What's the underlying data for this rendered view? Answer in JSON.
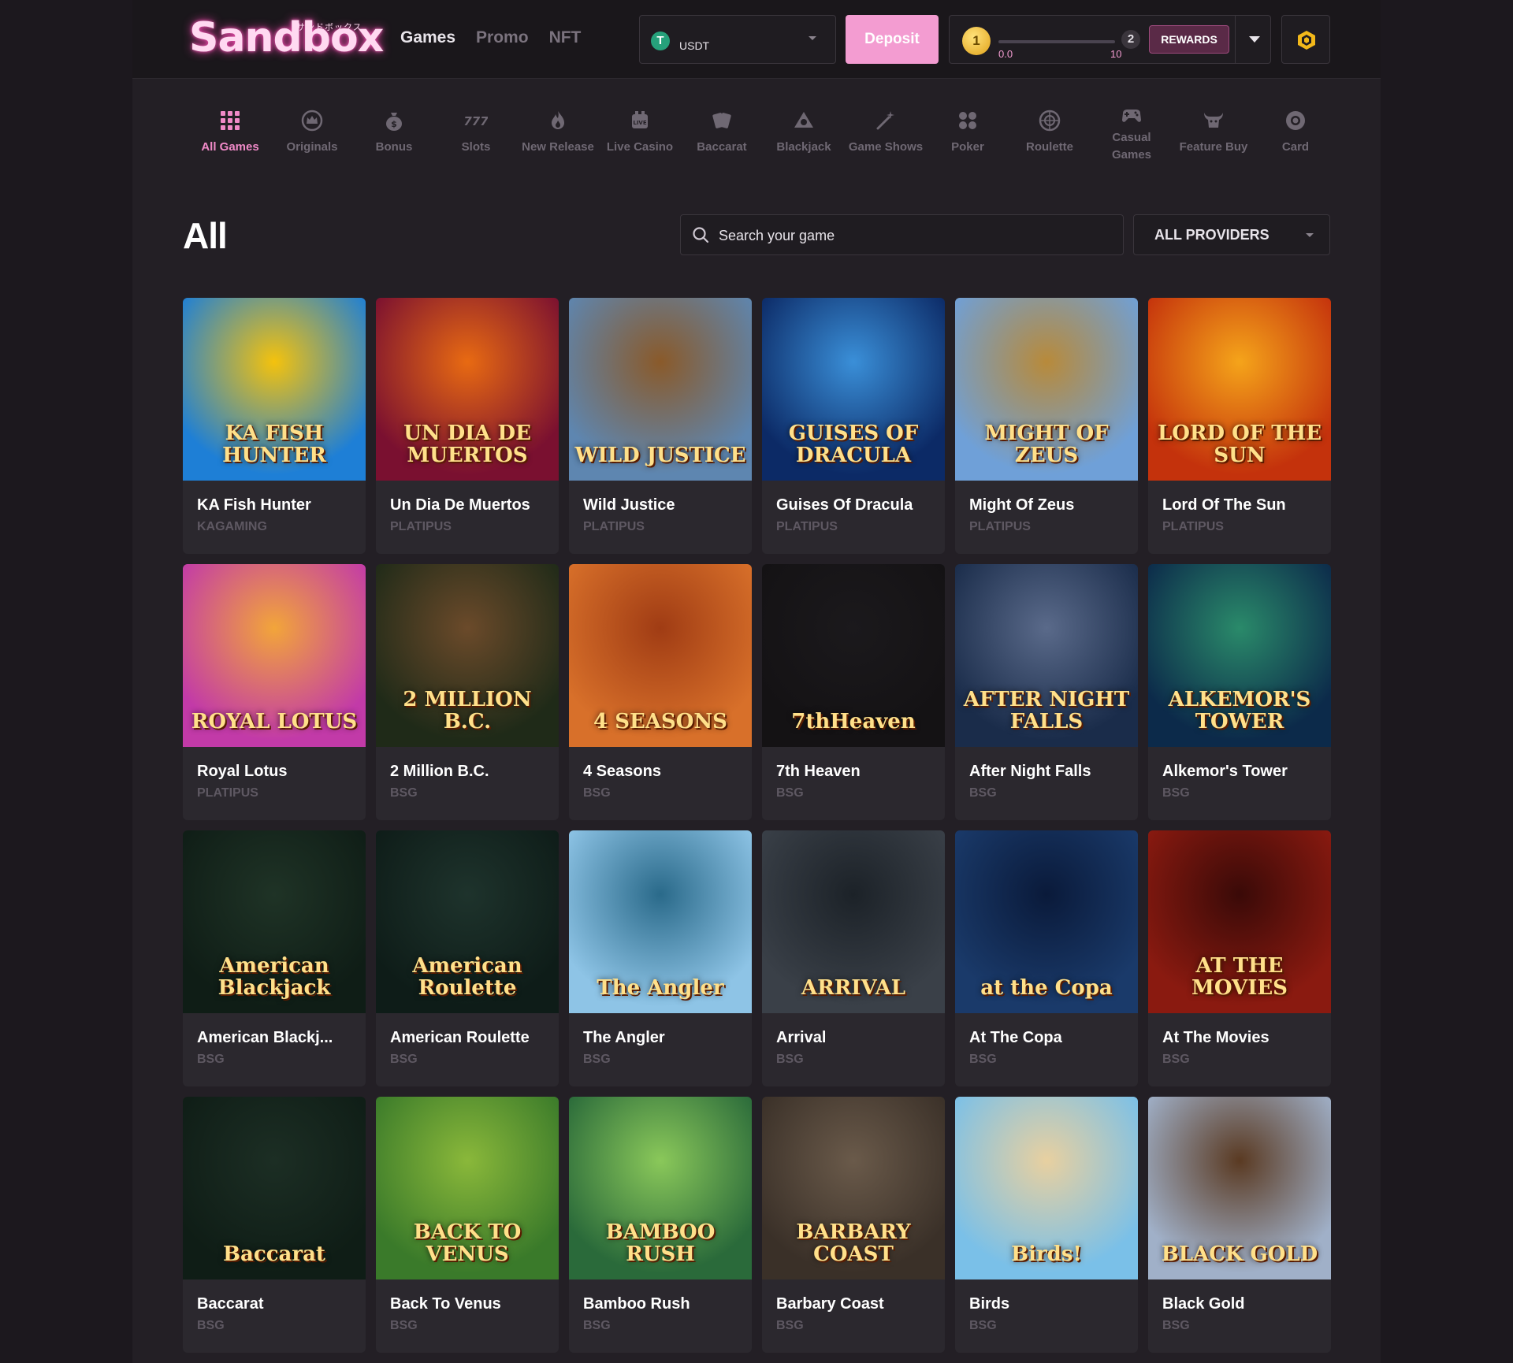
{
  "header": {
    "logo": "Sandbox",
    "logo_sub": "サンドボックス",
    "nav": [
      "Games",
      "Promo",
      "NFT"
    ],
    "wallet_currency": "USDT",
    "tether_glyph": "T",
    "deposit_label": "Deposit",
    "level_current": "1",
    "level_next": "2",
    "progress_min": "0.0",
    "progress_max": "10",
    "progress_fraction": 0.0,
    "rewards_label": "REWARDS"
  },
  "categories": [
    {
      "label": "All Games",
      "icon": "grid-icon"
    },
    {
      "label": "Originals",
      "icon": "crown-badge-icon"
    },
    {
      "label": "Bonus",
      "icon": "money-bag-icon"
    },
    {
      "label": "Slots",
      "icon": "slots-777-icon"
    },
    {
      "label": "New Release",
      "icon": "flame-icon"
    },
    {
      "label": "Live Casino",
      "icon": "live-casino-icon"
    },
    {
      "label": "Baccarat",
      "icon": "cards-icon"
    },
    {
      "label": "Blackjack",
      "icon": "club-chip-icon"
    },
    {
      "label": "Game Shows",
      "icon": "magic-wand-icon"
    },
    {
      "label": "Poker",
      "icon": "poker-suits-icon"
    },
    {
      "label": "Roulette",
      "icon": "roulette-wheel-icon"
    },
    {
      "label": "Casual Games",
      "icon": "gamepad-icon"
    },
    {
      "label": "Feature Buy",
      "icon": "bull-icon"
    },
    {
      "label": "Card",
      "icon": "chip-icon"
    }
  ],
  "section_title": "All",
  "search": {
    "placeholder": "Search your game"
  },
  "providers_label": "ALL PROVIDERS",
  "games": [
    {
      "name": "KA Fish Hunter",
      "provider": "KAGAMING",
      "art": "KA FISH HUNTER",
      "colors": [
        "#1e7fd6",
        "#f4c20d"
      ]
    },
    {
      "name": "Un Dia De Muertos",
      "provider": "PLATIPUS",
      "art": "UN DIA DE MUERTOS",
      "colors": [
        "#7a1030",
        "#e86a12"
      ]
    },
    {
      "name": "Wild Justice",
      "provider": "PLATIPUS",
      "art": "WILD JUSTICE",
      "colors": [
        "#5e86b0",
        "#8a5a2a"
      ]
    },
    {
      "name": "Guises Of Dracula",
      "provider": "PLATIPUS",
      "art": "GUISES OF DRACULA",
      "colors": [
        "#0c2a66",
        "#3a8fd8"
      ]
    },
    {
      "name": "Might Of Zeus",
      "provider": "PLATIPUS",
      "art": "MIGHT OF ZEUS",
      "colors": [
        "#6fa0d8",
        "#b88a3a"
      ]
    },
    {
      "name": "Lord Of The Sun",
      "provider": "PLATIPUS",
      "art": "LORD OF THE SUN",
      "colors": [
        "#c4320c",
        "#f5a41a"
      ]
    },
    {
      "name": "Royal Lotus",
      "provider": "PLATIPUS",
      "art": "ROYAL LOTUS",
      "colors": [
        "#c23aa8",
        "#f2a53a"
      ]
    },
    {
      "name": "2 Million B.C.",
      "provider": "BSG",
      "art": "2 MILLION B.C.",
      "colors": [
        "#1f2a18",
        "#6b4a2a"
      ]
    },
    {
      "name": "4 Seasons",
      "provider": "BSG",
      "art": "4 SEASONS",
      "colors": [
        "#d8702a",
        "#a03c14"
      ]
    },
    {
      "name": "7th Heaven",
      "provider": "BSG",
      "art": "7thHeaven",
      "colors": [
        "#141214",
        "#1b191c"
      ]
    },
    {
      "name": "After Night Falls",
      "provider": "BSG",
      "art": "AFTER NIGHT FALLS",
      "colors": [
        "#1a2c4a",
        "#5a6a8a"
      ]
    },
    {
      "name": "Alkemor's Tower",
      "provider": "BSG",
      "art": "ALKEMOR'S TOWER",
      "colors": [
        "#0c2a4a",
        "#2a8a6a"
      ]
    },
    {
      "name": "American Blackj...",
      "provider": "BSG",
      "art": "American Blackjack",
      "colors": [
        "#0f1d16",
        "#1f3326"
      ]
    },
    {
      "name": "American Roulette",
      "provider": "BSG",
      "art": "American Roulette",
      "colors": [
        "#0e1c18",
        "#1e332c"
      ]
    },
    {
      "name": "The Angler",
      "provider": "BSG",
      "art": "The Angler",
      "colors": [
        "#8ec4e6",
        "#2a6a8a"
      ]
    },
    {
      "name": "Arrival",
      "provider": "BSG",
      "art": "ARRIVAL",
      "colors": [
        "#3a4048",
        "#1c2228"
      ]
    },
    {
      "name": "At The Copa",
      "provider": "BSG",
      "art": "at the Copa",
      "colors": [
        "#1a3a6a",
        "#0a1a3a"
      ]
    },
    {
      "name": "At The Movies",
      "provider": "BSG",
      "art": "AT THE MOVIES",
      "colors": [
        "#8a1a10",
        "#3a0a08"
      ]
    },
    {
      "name": "Baccarat",
      "provider": "BSG",
      "art": "Baccarat",
      "colors": [
        "#0f1d16",
        "#1c2e24"
      ]
    },
    {
      "name": "Back To Venus",
      "provider": "BSG",
      "art": "BACK TO VENUS",
      "colors": [
        "#3a7a2a",
        "#8ab83a"
      ]
    },
    {
      "name": "Bamboo Rush",
      "provider": "BSG",
      "art": "BAMBOO RUSH",
      "colors": [
        "#2a6a3a",
        "#8ac85a"
      ]
    },
    {
      "name": "Barbary Coast",
      "provider": "BSG",
      "art": "BARBARY COAST",
      "colors": [
        "#3a3028",
        "#6a5a4a"
      ]
    },
    {
      "name": "Birds",
      "provider": "BSG",
      "art": "Birds!",
      "colors": [
        "#7ac0e8",
        "#e8d0a0"
      ]
    },
    {
      "name": "Black Gold",
      "provider": "BSG",
      "art": "BLACK GOLD",
      "colors": [
        "#a0b0c8",
        "#5a3a22"
      ]
    }
  ]
}
